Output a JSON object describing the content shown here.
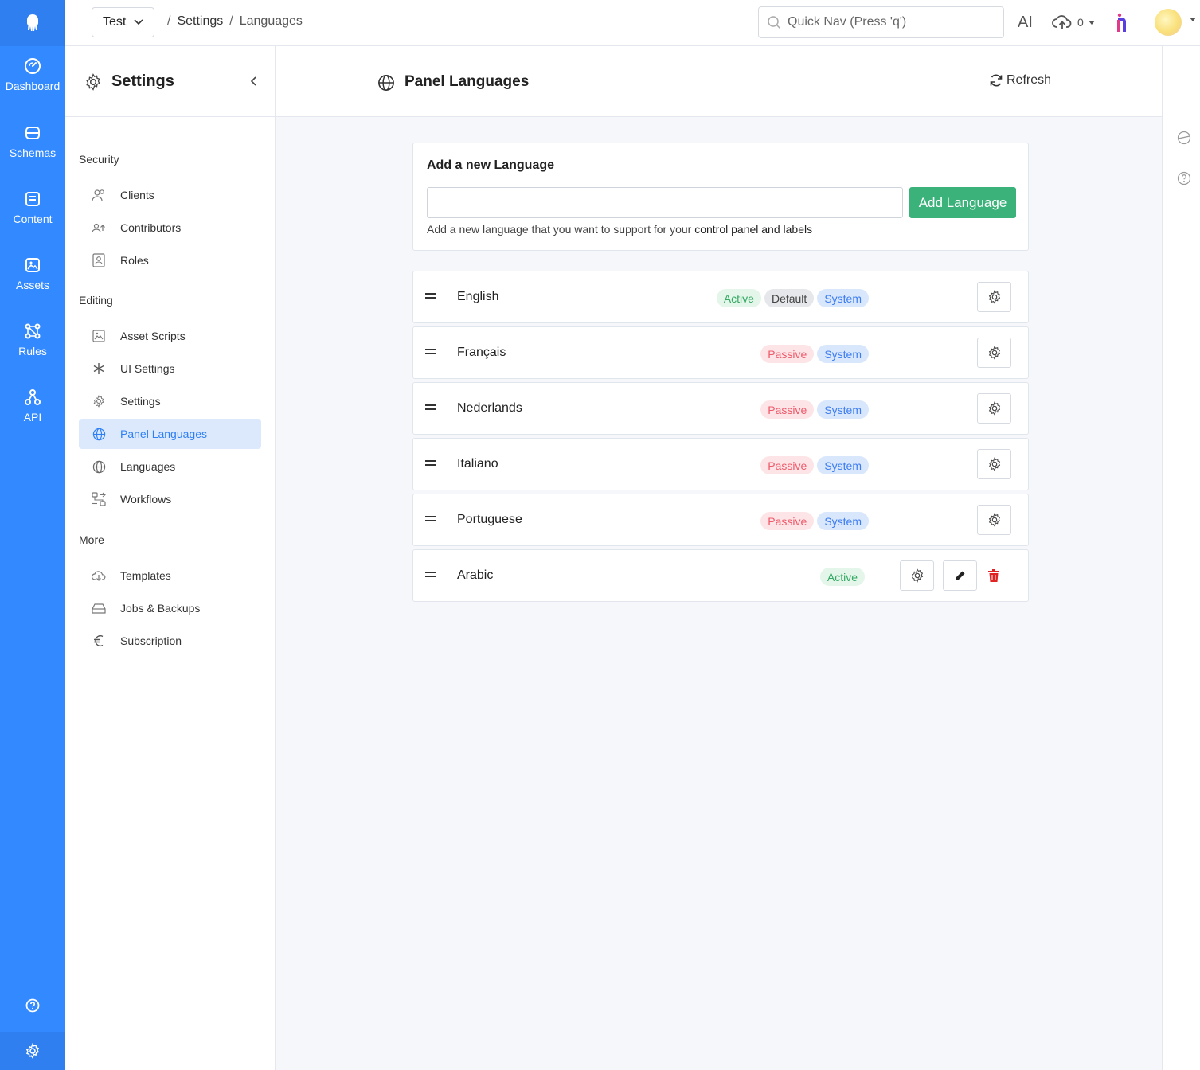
{
  "topbar": {
    "app_name": "Test",
    "breadcrumb": [
      "Settings",
      "Languages"
    ],
    "quicknav_placeholder": "Quick Nav (Press 'q')",
    "ai_label": "AI",
    "uploads_count": "0"
  },
  "rail": {
    "items": [
      {
        "label": "Dashboard",
        "icon": "gauge-icon"
      },
      {
        "label": "Schemas",
        "icon": "database-icon"
      },
      {
        "label": "Content",
        "icon": "document-icon"
      },
      {
        "label": "Assets",
        "icon": "image-icon"
      },
      {
        "label": "Rules",
        "icon": "rules-icon"
      },
      {
        "label": "API",
        "icon": "api-icon"
      }
    ]
  },
  "sidebar": {
    "title": "Settings",
    "groups": [
      {
        "label": "Security",
        "items": [
          "Clients",
          "Contributors",
          "Roles"
        ]
      },
      {
        "label": "Editing",
        "items": [
          "Asset Scripts",
          "UI Settings",
          "Settings",
          "Panel Languages",
          "Languages",
          "Workflows"
        ]
      },
      {
        "label": "More",
        "items": [
          "Templates",
          "Jobs & Backups",
          "Subscription"
        ]
      }
    ],
    "active_item": "Panel Languages"
  },
  "main": {
    "title": "Panel Languages",
    "refresh_label": "Refresh",
    "add_card": {
      "heading": "Add a new Language",
      "input_value": "",
      "button_label": "Add Language",
      "hint_prefix": "Add a new language that you want to support for your ",
      "hint_bold": "control panel and labels"
    },
    "languages": [
      {
        "name": "English",
        "badges": [
          "Active",
          "Default",
          "System"
        ]
      },
      {
        "name": "Français",
        "badges": [
          "Passive",
          "System"
        ]
      },
      {
        "name": "Nederlands",
        "badges": [
          "Passive",
          "System"
        ]
      },
      {
        "name": "Italiano",
        "badges": [
          "Passive",
          "System"
        ]
      },
      {
        "name": "Portuguese",
        "badges": [
          "Passive",
          "System"
        ]
      },
      {
        "name": "Arabic",
        "badges": [
          "Active"
        ]
      }
    ]
  },
  "colors": {
    "rail": "#3389ff",
    "accent_green": "#3ab27a",
    "active_nav_bg": "#dce9fd",
    "delete_red": "#e02424"
  }
}
